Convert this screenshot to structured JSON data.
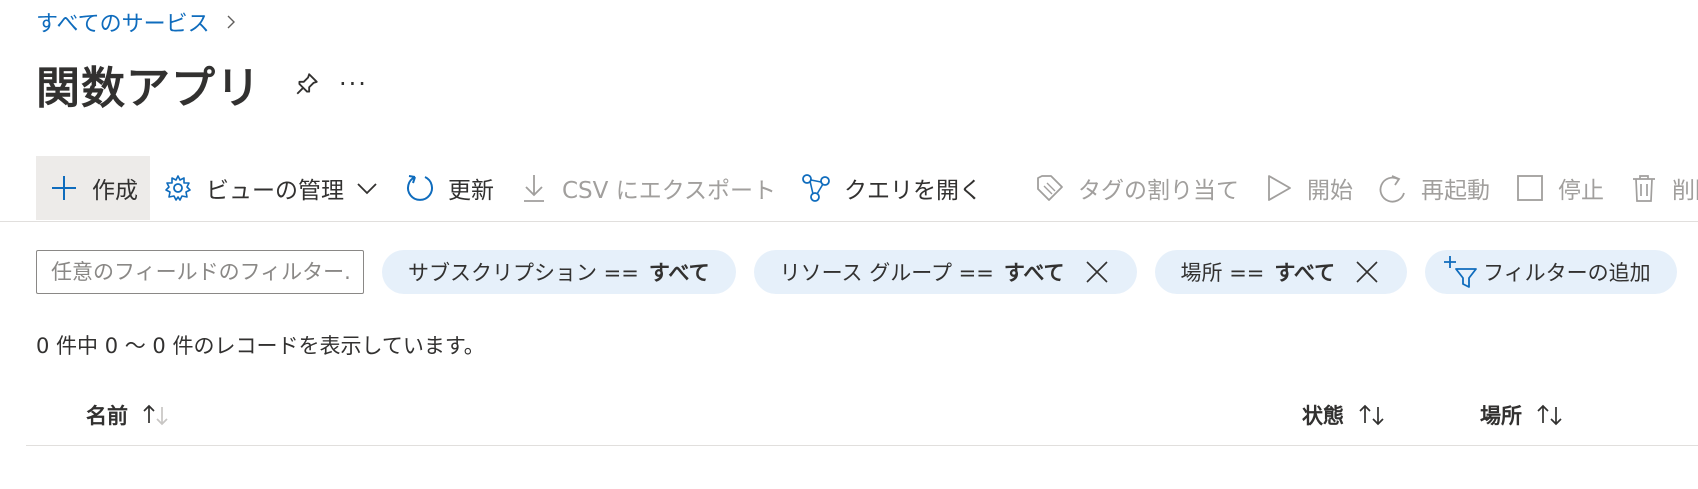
{
  "breadcrumb": {
    "all_services": "すべてのサービス"
  },
  "page": {
    "title": "関数アプリ",
    "more": "···"
  },
  "toolbar": {
    "create": "作成",
    "manage_view": "ビューの管理",
    "refresh": "更新",
    "export_csv": "CSV にエクスポート",
    "open_query": "クエリを開く",
    "assign_tags": "タグの割り当て",
    "start": "開始",
    "restart": "再起動",
    "stop": "停止",
    "delete": "削除"
  },
  "filters": {
    "search_placeholder": "任意のフィールドのフィルター...",
    "subscription": {
      "label": "サブスクリプション ==",
      "value": "すべて"
    },
    "resource_group": {
      "label": "リソース グループ ==",
      "value": "すべて"
    },
    "location": {
      "label": "場所 ==",
      "value": "すべて"
    },
    "add_filter": "フィルターの追加"
  },
  "records_text": "0 件中 0 ～ 0 件のレコードを表示しています。",
  "table": {
    "columns": [
      "名前",
      "状態",
      "場所"
    ]
  },
  "colors": {
    "link": "#0f6cbd",
    "pill_bg": "#e6f0fa",
    "icon_blue": "#0f6cbd",
    "disabled": "#a19f9d"
  },
  "icons": {
    "breadcrumb": "chevron-right-icon",
    "title": [
      "pin-icon",
      "more-icon"
    ],
    "toolbar": [
      "plus-icon",
      "gear-icon",
      "refresh-icon",
      "download-icon",
      "query-icon",
      "tag-icon",
      "play-icon",
      "restart-icon",
      "stop-icon",
      "trash-icon"
    ],
    "filters": [
      "close-icon",
      "add-filter-icon"
    ],
    "sort": "sort-arrows-icon"
  }
}
